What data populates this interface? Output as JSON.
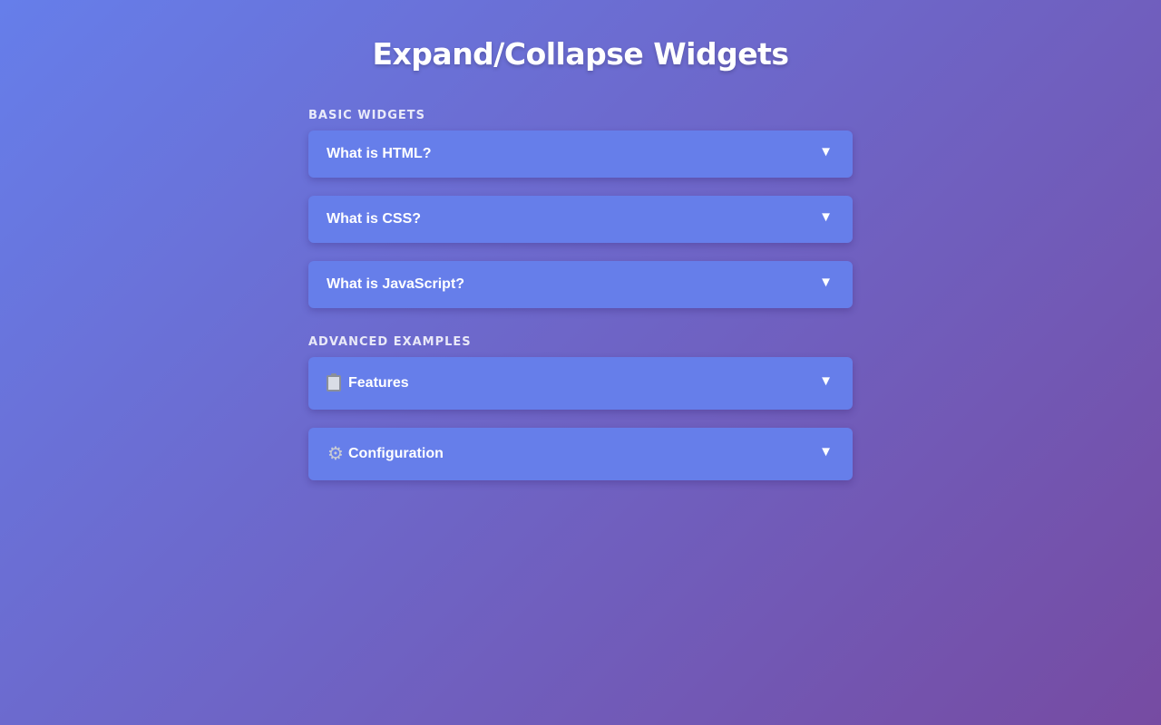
{
  "page": {
    "title": "Expand/Collapse Widgets"
  },
  "sections": {
    "basic": {
      "title": "Basic Widgets",
      "items": [
        {
          "label": "What is HTML?"
        },
        {
          "label": "What is CSS?"
        },
        {
          "label": "What is JavaScript?"
        }
      ]
    },
    "advanced": {
      "title": "Advanced Examples",
      "items": [
        {
          "label": "Features",
          "icon": "clipboard-icon"
        },
        {
          "label": "Configuration",
          "icon": "gear-icon"
        }
      ]
    }
  },
  "icons": {
    "chevron": "▼",
    "gear": "⚙"
  },
  "colors": {
    "gradient_start": "#667eea",
    "gradient_end": "#764ba2",
    "widget_bg": "#667eea"
  }
}
